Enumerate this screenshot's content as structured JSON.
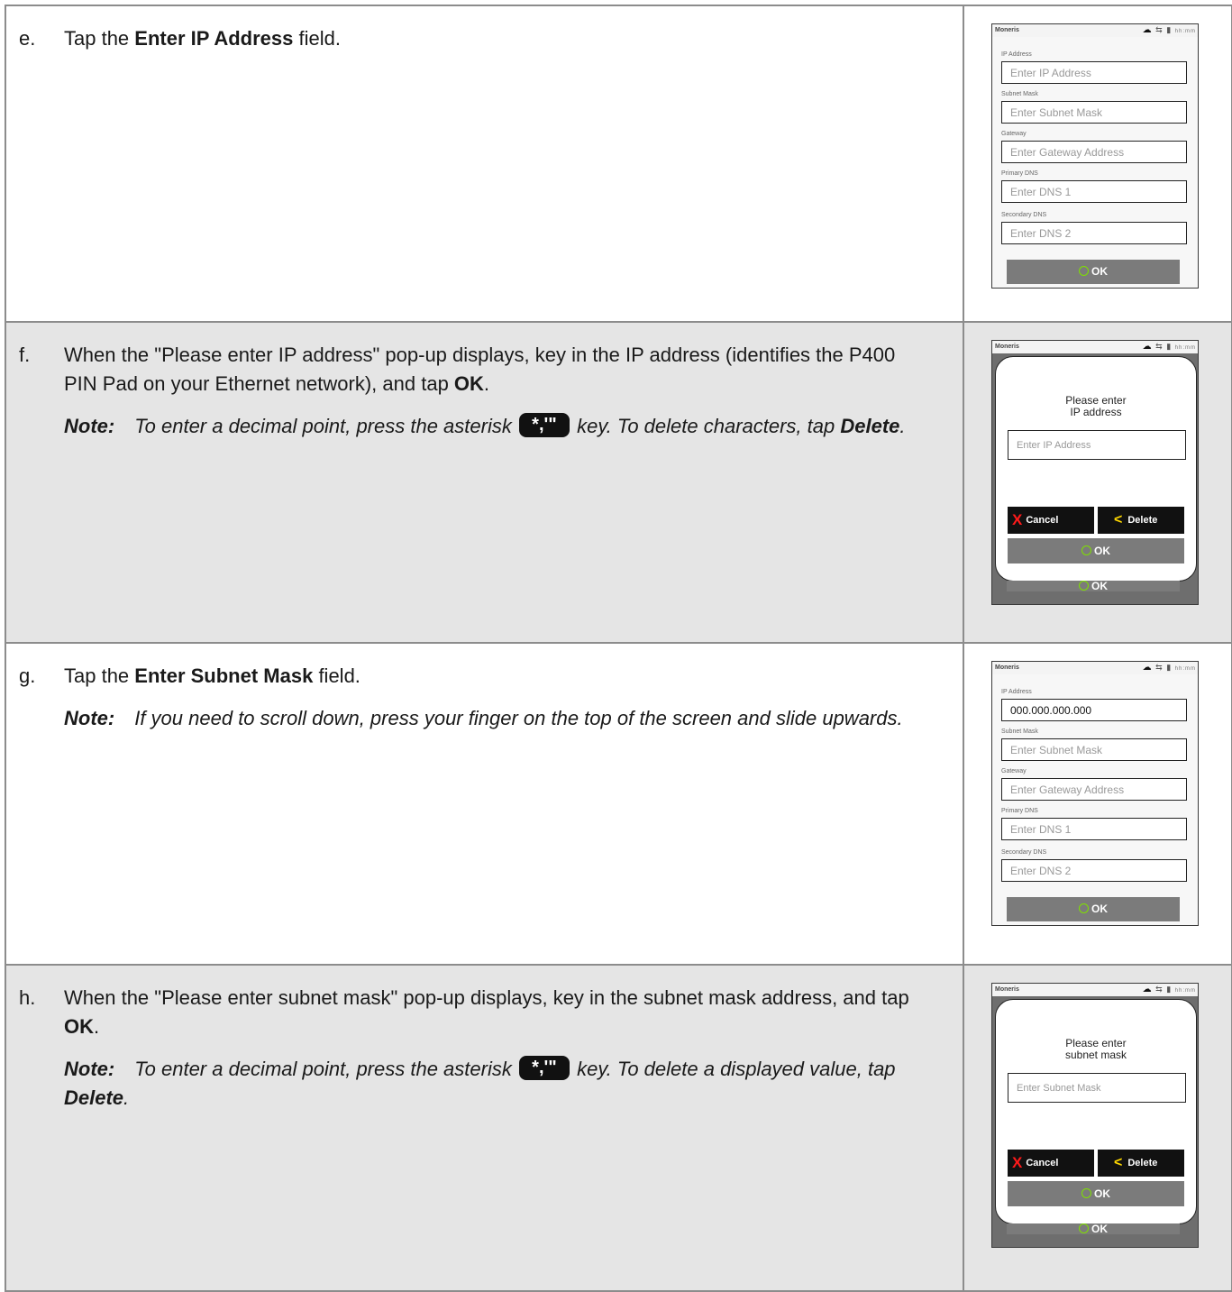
{
  "device": {
    "brand": "Moneris",
    "time": "hh:mm"
  },
  "ok_label": "OK",
  "form": {
    "ip_label": "IP Address",
    "ip_placeholder": "Enter IP Address",
    "ip_value": "000.000.000.000",
    "subnet_label": "Subnet Mask",
    "subnet_placeholder": "Enter Subnet Mask",
    "gateway_label": "Gateway",
    "gateway_placeholder": "Enter Gateway Address",
    "dns1_label": "Primary DNS",
    "dns1_placeholder": "Enter DNS 1",
    "dns2_label": "Secondary DNS",
    "dns2_placeholder": "Enter DNS 2"
  },
  "popup": {
    "ip_title_line1": "Please enter",
    "ip_title_line2": "IP address",
    "ip_placeholder": "Enter IP Address",
    "subnet_title_line1": "Please enter",
    "subnet_title_line2": "subnet mask",
    "subnet_placeholder": "Enter Subnet Mask",
    "cancel_label": "Cancel",
    "delete_label": "Delete"
  },
  "key_glyph": "*,'\"",
  "steps": {
    "e": {
      "letter": "e.",
      "pre": "Tap the ",
      "bold": "Enter IP Address",
      "post": " field."
    },
    "f": {
      "letter": "f.",
      "text": "When the \"Please enter IP address\" pop-up displays, key in the IP address (identifies the P400 PIN Pad on your Ethernet network), and tap ",
      "bold": "OK",
      "post": ".",
      "note_label": "Note:",
      "note_pre": "To enter a decimal point, press the asterisk ",
      "note_mid": " key.  To delete characters, tap ",
      "note_bold": "Delete",
      "note_post": "."
    },
    "g": {
      "letter": "g.",
      "pre": "Tap the ",
      "bold": "Enter Subnet Mask",
      "post": " field.",
      "note_label": "Note:",
      "note_text": "If you need to scroll down, press your finger on the top of the screen and slide upwards."
    },
    "h": {
      "letter": "h.",
      "text": "When the \"Please enter subnet mask\" pop-up displays, key in the subnet mask address, and tap ",
      "bold": "OK",
      "post": ".",
      "note_label": "Note:",
      "note_pre": "To enter a decimal point, press the asterisk ",
      "note_mid": " key.  To delete a displayed value, tap ",
      "note_bold": "Delete",
      "note_post": "."
    }
  }
}
